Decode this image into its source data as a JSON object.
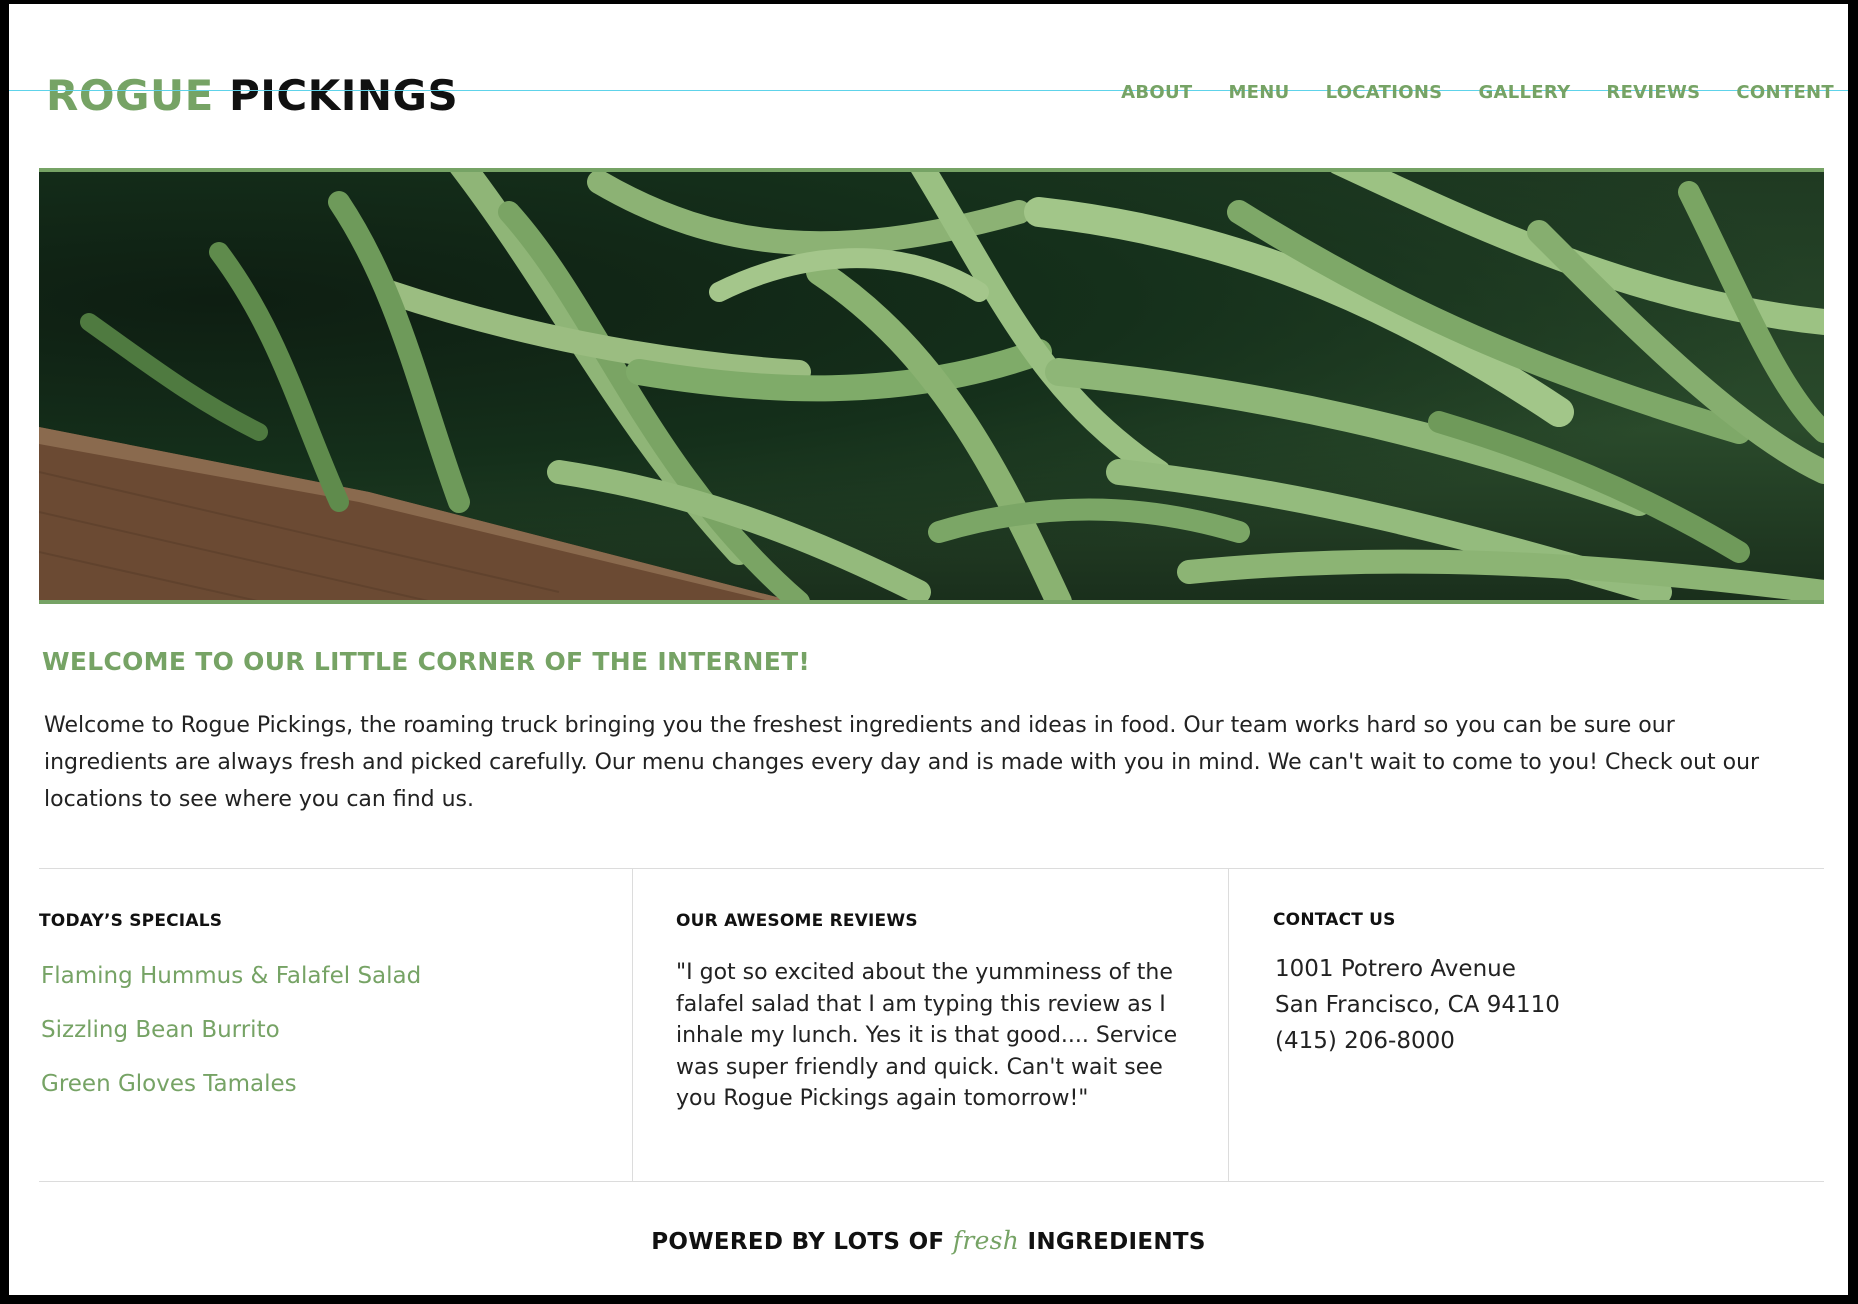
{
  "header": {
    "logo_part1": "ROGUE",
    "logo_part2": "PICKINGS",
    "nav": [
      "ABOUT",
      "MENU",
      "LOCATIONS",
      "GALLERY",
      "REVIEWS",
      "CONTENT"
    ]
  },
  "hero": {
    "image_icon": "green-beans-photo"
  },
  "welcome": {
    "title": "WELCOME TO OUR LITTLE CORNER OF THE INTERNET!",
    "body": "Welcome to Rogue Pickings, the roaming truck bringing you the freshest ingredients and ideas in food. Our team works hard so you can be sure our ingredients are always fresh and picked carefully. Our menu changes every day and is made with you in mind. We can't wait to come to you! Check out our locations to see where you can find us."
  },
  "specials": {
    "title": "TODAY’S SPECIALS",
    "items": [
      "Flaming Hummus & Falafel Salad",
      "Sizzling Bean Burrito",
      "Green Gloves Tamales"
    ]
  },
  "reviews": {
    "title": "OUR AWESOME REVIEWS",
    "quote": "\"I got so excited about the yumminess of the falafel salad that I am typing this review as I inhale my lunch. Yes it is that good.... Service was super friendly and quick. Can't wait see you Rogue Pickings again tomorrow!\""
  },
  "contact": {
    "title": "CONTACT US",
    "address1": "1001 Potrero Avenue",
    "address2": "San Francisco, CA 94110",
    "phone": "(415) 206-8000"
  },
  "footer": {
    "before": "POWERED BY LOTS OF",
    "fresh": "fresh",
    "after": "INGREDIENTS"
  },
  "colors": {
    "accent": "#76a365",
    "text": "#222222"
  }
}
